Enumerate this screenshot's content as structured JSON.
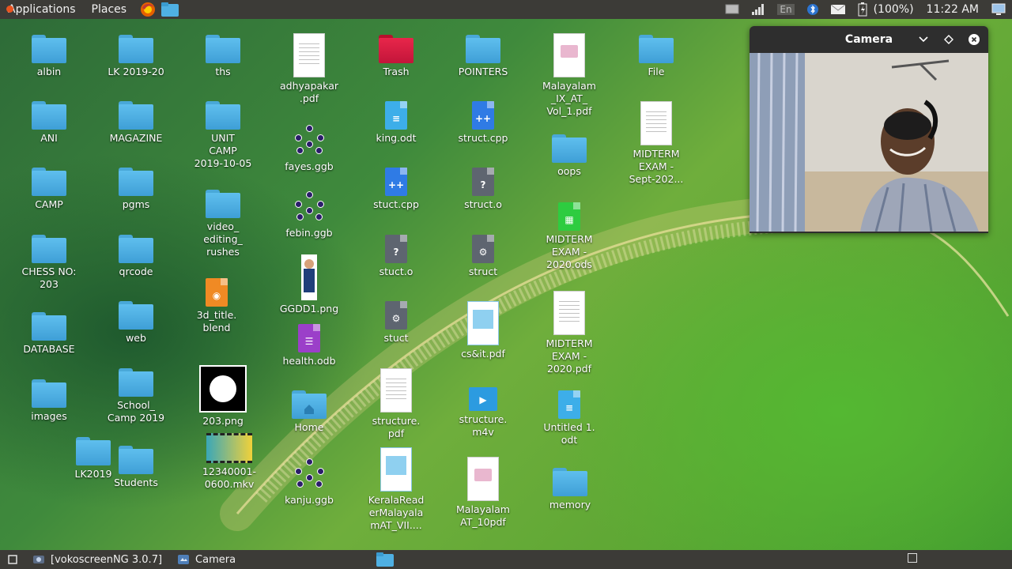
{
  "top_panel": {
    "menus": [
      "Applications",
      "Places"
    ],
    "tray": {
      "input_method": "En",
      "battery": "(100%)",
      "time": "11:22 AM"
    }
  },
  "desktop_icons": [
    {
      "label": "albin",
      "kind": "folder"
    },
    {
      "label": "ANI",
      "kind": "folder"
    },
    {
      "label": "CAMP",
      "kind": "folder"
    },
    {
      "label": "CHESS NO:\n203",
      "kind": "folder"
    },
    {
      "label": "DATABASE",
      "kind": "folder"
    },
    {
      "label": "images",
      "kind": "folder"
    },
    {
      "label": "LK2019",
      "kind": "folder"
    },
    {
      "label": "LK 2019-20",
      "kind": "folder"
    },
    {
      "label": "MAGAZINE",
      "kind": "folder"
    },
    {
      "label": "pgms",
      "kind": "folder"
    },
    {
      "label": "qrcode",
      "kind": "folder"
    },
    {
      "label": "web",
      "kind": "folder"
    },
    {
      "label": "School_\nCamp 2019",
      "kind": "folder"
    },
    {
      "label": "Students",
      "kind": "folder"
    },
    {
      "label": "ths",
      "kind": "folder"
    },
    {
      "label": "UNIT\nCAMP\n2019-10-05",
      "kind": "folder"
    },
    {
      "label": "video_\nediting_\nrushes",
      "kind": "folder"
    },
    {
      "label": "3d_title.\nblend",
      "kind": "blend"
    },
    {
      "label": "203.png",
      "kind": "image-gear"
    },
    {
      "label": "12340001-\n0600.mkv",
      "kind": "video-thumb"
    },
    {
      "label": "adhyapakar\n.pdf",
      "kind": "doc"
    },
    {
      "label": "fayes.ggb",
      "kind": "ggb"
    },
    {
      "label": "febin.ggb",
      "kind": "ggb"
    },
    {
      "label": "GGDD1.png",
      "kind": "image-person"
    },
    {
      "label": "health.odb",
      "kind": "odb"
    },
    {
      "label": "Home",
      "kind": "home-folder"
    },
    {
      "label": "kanju.ggb",
      "kind": "ggb"
    },
    {
      "label": "Trash",
      "kind": "trash"
    },
    {
      "label": "king.odt",
      "kind": "odt"
    },
    {
      "label": "stuct.cpp",
      "kind": "cpp"
    },
    {
      "label": "stuct.o",
      "kind": "object"
    },
    {
      "label": "stuct",
      "kind": "exec"
    },
    {
      "label": "structure.\npdf",
      "kind": "doc"
    },
    {
      "label": "KeralaRead\nerMalayala\nmAT_VII....",
      "kind": "doc-blue"
    },
    {
      "label": "POINTERS",
      "kind": "folder"
    },
    {
      "label": "struct.cpp",
      "kind": "cpp"
    },
    {
      "label": "struct.o",
      "kind": "object"
    },
    {
      "label": "struct",
      "kind": "exec"
    },
    {
      "label": "cs&it.pdf",
      "kind": "doc-blue"
    },
    {
      "label": "structure.\nm4v",
      "kind": "m4v"
    },
    {
      "label": "Malayalam\nAT_10pdf",
      "kind": "doc-pink"
    },
    {
      "label": "Malayalam\n_IX_AT_\nVol_1.pdf",
      "kind": "doc-pink"
    },
    {
      "label": "oops",
      "kind": "folder"
    },
    {
      "label": "MIDTERM\nEXAM -\n2020.ods",
      "kind": "ods"
    },
    {
      "label": "MIDTERM\nEXAM -\n2020.pdf",
      "kind": "doc"
    },
    {
      "label": "Untitled 1.\nodt",
      "kind": "odt"
    },
    {
      "label": "memory",
      "kind": "folder"
    },
    {
      "label": "File",
      "kind": "folder"
    },
    {
      "label": "MIDTERM\nEXAM -\nSept-202...",
      "kind": "doc"
    }
  ],
  "camera_window": {
    "title": "Camera"
  },
  "taskbar": {
    "tasks": [
      {
        "label": "[vokoscreenNG 3.0.7]"
      },
      {
        "label": "Camera"
      }
    ]
  },
  "colors": {
    "panel": "#3c3b37",
    "folder": "#4fb0e3",
    "trash": "#d91b42"
  }
}
